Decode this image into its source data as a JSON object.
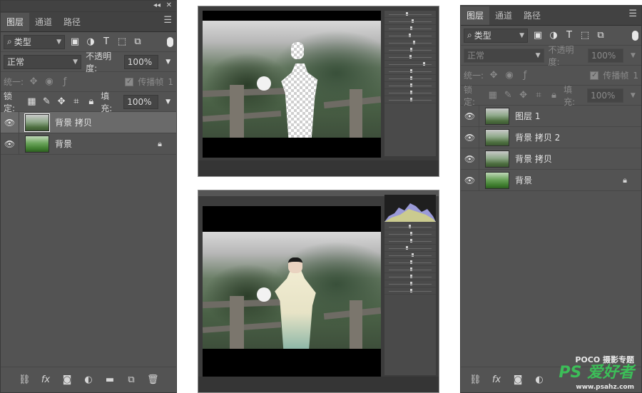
{
  "left_panel": {
    "tabs": [
      "图层",
      "通道",
      "路径"
    ],
    "filter_kind": "类型",
    "blend_mode": "正常",
    "opacity_label": "不透明度:",
    "opacity_value": "100%",
    "unify_label": "统一:",
    "propagate_label": "传播帧",
    "propagate_value": "1",
    "lock_label": "锁定:",
    "fill_label": "填充:",
    "fill_value": "100%",
    "layers": [
      {
        "name": "背景 拷贝",
        "selected": true,
        "locked": false
      },
      {
        "name": "背景",
        "selected": false,
        "locked": true
      }
    ]
  },
  "right_panel": {
    "tabs": [
      "图层",
      "通道",
      "路径"
    ],
    "filter_kind": "类型",
    "blend_mode": "正常",
    "opacity_label": "不透明度:",
    "opacity_value": "100%",
    "unify_label": "统一:",
    "propagate_label": "传播帧",
    "propagate_value": "1",
    "lock_label": "锁定:",
    "fill_label": "填充:",
    "fill_value": "100%",
    "layers": [
      {
        "name": "图层 1",
        "selected": false,
        "locked": false
      },
      {
        "name": "背景 拷贝 2",
        "selected": false,
        "locked": false
      },
      {
        "name": "背景 拷贝",
        "selected": false,
        "locked": false
      },
      {
        "name": "背景",
        "selected": false,
        "locked": true
      }
    ]
  },
  "watermark": {
    "line1": "POCO 摄影专题",
    "line2": "PS 爱好者",
    "line3": "www.psahz.com"
  },
  "colors": {
    "panel_bg": "#535353",
    "selected_row": "#6a6a6a",
    "search_button": "#c0332b",
    "watermark_green": "#3cbe58"
  }
}
